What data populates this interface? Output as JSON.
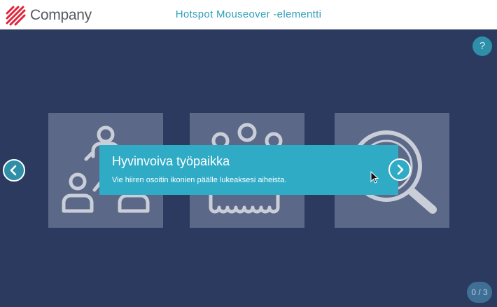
{
  "header": {
    "brand": "Company",
    "title": "Hotspot Mouseover -elementti",
    "logo_color": "#e0243a"
  },
  "help": {
    "label": "?"
  },
  "tiles": [
    {
      "icon": "people-network-icon"
    },
    {
      "icon": "group-of-people-icon"
    },
    {
      "icon": "magnifying-glass-icon"
    }
  ],
  "tooltip": {
    "title": "Hyvinvoiva työpaikka",
    "text": "Vie hiiren osoitin ikonien päälle lukeaksesi aiheista."
  },
  "nav": {
    "prev_icon": "chevron-left-icon",
    "next_icon": "chevron-right-icon"
  },
  "counter": {
    "label": "0 / 3"
  },
  "colors": {
    "background": "#2b3a5e",
    "tile": "#5b6888",
    "tooltip": "#2fabc6",
    "accent": "#2e9fb8"
  }
}
